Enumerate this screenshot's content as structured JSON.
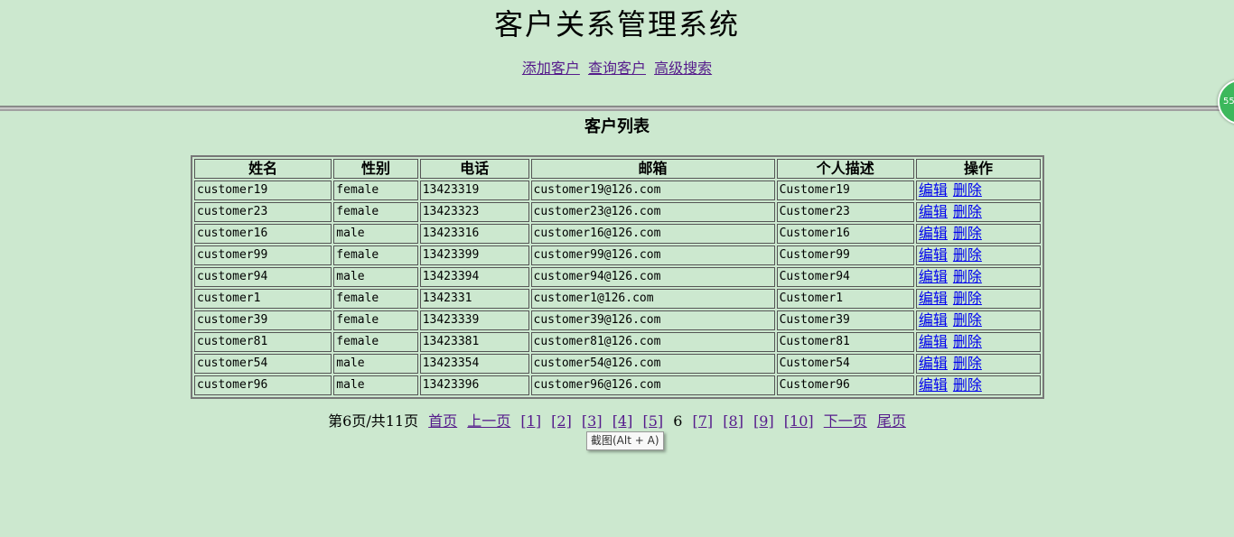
{
  "header": {
    "title": "客户关系管理系统"
  },
  "nav": {
    "links": [
      "添加客户",
      "查询客户",
      "高级搜索"
    ]
  },
  "float_ball": {
    "text": "55"
  },
  "section": {
    "title": "客户列表"
  },
  "table": {
    "columns": [
      "姓名",
      "性别",
      "电话",
      "邮箱",
      "个人描述",
      "操作"
    ],
    "edit_label": "编辑",
    "delete_label": "删除",
    "rows": [
      [
        "customer19",
        "female",
        "13423319",
        "customer19@126.com",
        "Customer19"
      ],
      [
        "customer23",
        "female",
        "13423323",
        "customer23@126.com",
        "Customer23"
      ],
      [
        "customer16",
        "male",
        "13423316",
        "customer16@126.com",
        "Customer16"
      ],
      [
        "customer99",
        "female",
        "13423399",
        "customer99@126.com",
        "Customer99"
      ],
      [
        "customer94",
        "male",
        "13423394",
        "customer94@126.com",
        "Customer94"
      ],
      [
        "customer1",
        "female",
        "1342331",
        "customer1@126.com",
        "Customer1"
      ],
      [
        "customer39",
        "female",
        "13423339",
        "customer39@126.com",
        "Customer39"
      ],
      [
        "customer81",
        "female",
        "13423381",
        "customer81@126.com",
        "Customer81"
      ],
      [
        "customer54",
        "male",
        "13423354",
        "customer54@126.com",
        "Customer54"
      ],
      [
        "customer96",
        "male",
        "13423396",
        "customer96@126.com",
        "Customer96"
      ]
    ]
  },
  "pager": {
    "status": "第6页/共11页",
    "first": "首页",
    "prev": "上一页",
    "pages_before": [
      "[1]",
      "[2]",
      "[3]",
      "[4]",
      "[5]"
    ],
    "current": "6",
    "pages_after": [
      "[7]",
      "[8]",
      "[9]",
      "[10]"
    ],
    "next": "下一页",
    "last": "尾页"
  },
  "tooltip": {
    "text": "截图(Alt + A)"
  }
}
